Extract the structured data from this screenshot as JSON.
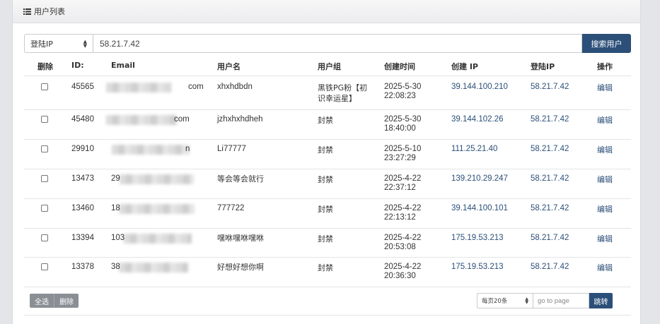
{
  "panel": {
    "title": "用户列表",
    "icon": "list-icon"
  },
  "search": {
    "field_selected": "登陆IP",
    "query": "58.21.7.42",
    "button_label": "搜索用户"
  },
  "table": {
    "headers": [
      "删除",
      "ID:",
      "Email",
      "用户名",
      "用户组",
      "创建时间",
      "创建 IP",
      "登陆IP",
      "操作"
    ],
    "rows": [
      {
        "id": "45565",
        "email_visible": "com",
        "username": "xhxhdbdn",
        "group_line1": "黑铁PG粉【初",
        "group_line2": "识幸运星】",
        "created_date": "2025-5-30",
        "created_time": "22:08:23",
        "create_ip": "39.144.100.210",
        "login_ip": "58.21.7.42",
        "action": "编辑"
      },
      {
        "id": "45480",
        "email_visible": "com",
        "username": "jzhxhxhdheh",
        "group_line1": "封禁",
        "group_line2": "",
        "created_date": "2025-5-30",
        "created_time": "18:40:00",
        "create_ip": "39.144.102.26",
        "login_ip": "58.21.7.42",
        "action": "编辑"
      },
      {
        "id": "29910",
        "email_visible": "n",
        "username": "Li77777",
        "group_line1": "封禁",
        "group_line2": "",
        "created_date": "2025-5-10",
        "created_time": "23:27:29",
        "create_ip": "111.25.21.40",
        "login_ip": "58.21.7.42",
        "action": "编辑"
      },
      {
        "id": "13473",
        "email_visible": "29",
        "username": "等会等会就行",
        "group_line1": "封禁",
        "group_line2": "",
        "created_date": "2025-4-22",
        "created_time": "22:37:12",
        "create_ip": "139.210.29.247",
        "login_ip": "58.21.7.42",
        "action": "编辑"
      },
      {
        "id": "13460",
        "email_visible": "18",
        "username": "777722",
        "group_line1": "封禁",
        "group_line2": "",
        "created_date": "2025-4-22",
        "created_time": "22:13:12",
        "create_ip": "39.144.100.101",
        "login_ip": "58.21.7.42",
        "action": "编辑"
      },
      {
        "id": "13394",
        "email_visible": "103",
        "username": "嘿咻嘿咻嘿咻",
        "group_line1": "封禁",
        "group_line2": "",
        "created_date": "2025-4-22",
        "created_time": "20:53:08",
        "create_ip": "175.19.53.213",
        "login_ip": "58.21.7.42",
        "action": "编辑"
      },
      {
        "id": "13378",
        "email_visible": "38",
        "username": "好想好想你啊",
        "group_line1": "封禁",
        "group_line2": "",
        "created_date": "2025-4-22",
        "created_time": "20:36:30",
        "create_ip": "175.19.53.213",
        "login_ip": "58.21.7.42",
        "action": "编辑"
      }
    ]
  },
  "footer": {
    "select_all_label": "全选",
    "delete_label": "删除",
    "page_size_selected": "每页20条",
    "goto_placeholder": "go to page",
    "jump_label": "跳转"
  },
  "colors": {
    "accent": "#2b4f78",
    "grey_button": "#8a8f95",
    "link": "#2b4f78"
  }
}
